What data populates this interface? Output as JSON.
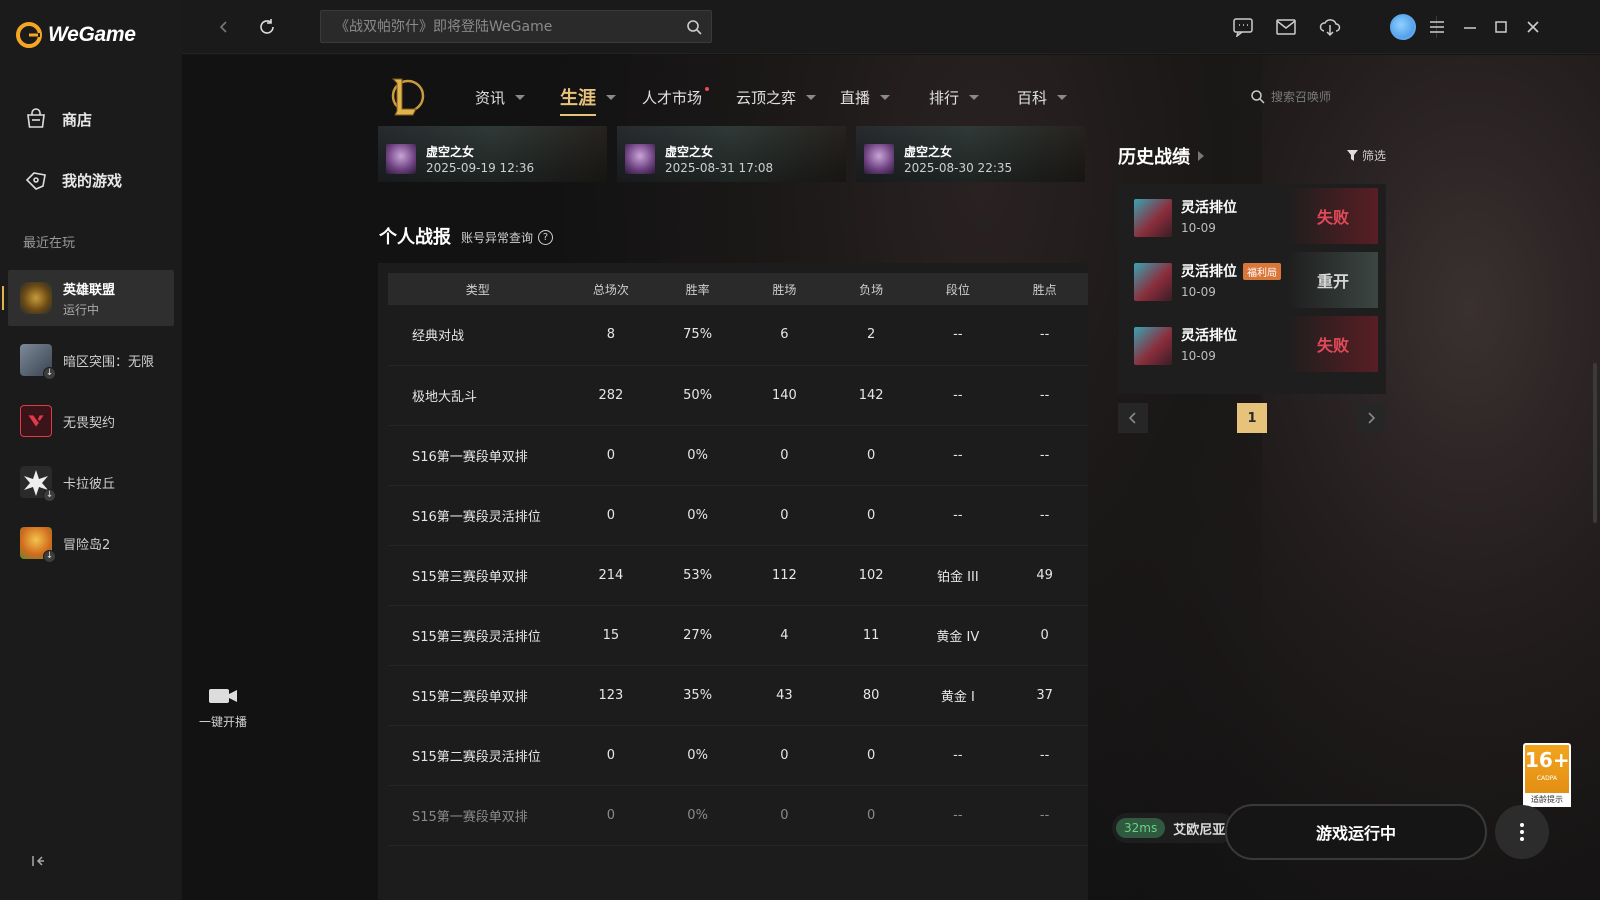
{
  "app": {
    "brand": "WeGame"
  },
  "sidebar": {
    "items": [
      {
        "label": "商店",
        "icon": "store-bag-icon"
      },
      {
        "label": "我的游戏",
        "icon": "gamepad-icon"
      }
    ],
    "recent_label": "最近在玩",
    "games": [
      {
        "name": "英雄联盟",
        "status": "运行中",
        "active": true
      },
      {
        "name": "暗区突围：无限"
      },
      {
        "name": "无畏契约"
      },
      {
        "name": "卡拉彼丘"
      },
      {
        "name": "冒险岛2"
      }
    ]
  },
  "topbar": {
    "search_placeholder": "《战双帕弥什》即将登陆WeGame"
  },
  "lol": {
    "nav": [
      {
        "label": "资讯"
      },
      {
        "label": "生涯",
        "active": true
      },
      {
        "label": "人才市场"
      },
      {
        "label": "云顶之弈"
      },
      {
        "label": "直播"
      },
      {
        "label": "排行"
      },
      {
        "label": "百科"
      }
    ],
    "summoner_search_placeholder": "搜索召唤师",
    "recent_matches": [
      {
        "champion": "虚空之女",
        "time": "2025-09-19 12:36"
      },
      {
        "champion": "虚空之女",
        "time": "2025-08-31 17:08"
      },
      {
        "champion": "虚空之女",
        "time": "2025-08-30 22:35"
      }
    ]
  },
  "stats": {
    "title": "个人战报",
    "link": "账号异常查询",
    "headers": [
      "类型",
      "总场次",
      "胜率",
      "胜场",
      "负场",
      "段位",
      "胜点"
    ],
    "rows": [
      [
        "经典对战",
        "8",
        "75%",
        "6",
        "2",
        "--",
        "--"
      ],
      [
        "极地大乱斗",
        "282",
        "50%",
        "140",
        "142",
        "--",
        "--"
      ],
      [
        "S16第一赛段单双排",
        "0",
        "0%",
        "0",
        "0",
        "--",
        "--"
      ],
      [
        "S16第一赛段灵活排位",
        "0",
        "0%",
        "0",
        "0",
        "--",
        "--"
      ],
      [
        "S15第三赛段单双排",
        "214",
        "53%",
        "112",
        "102",
        "铂金 III",
        "49"
      ],
      [
        "S15第三赛段灵活排位",
        "15",
        "27%",
        "4",
        "11",
        "黄金 IV",
        "0"
      ],
      [
        "S15第二赛段单双排",
        "123",
        "35%",
        "43",
        "80",
        "黄金 I",
        "37"
      ],
      [
        "S15第二赛段灵活排位",
        "0",
        "0%",
        "0",
        "0",
        "--",
        "--"
      ],
      [
        "S15第一赛段单双排",
        "0",
        "0%",
        "0",
        "0",
        "--",
        "--"
      ]
    ]
  },
  "history": {
    "title": "历史战绩",
    "filter": "筛选",
    "matches": [
      {
        "mode": "灵活排位",
        "date": "10-09",
        "result": "失败",
        "kind": "loss"
      },
      {
        "mode": "灵活排位",
        "date": "10-09",
        "result": "重开",
        "kind": "remake",
        "badge": "福利局"
      },
      {
        "mode": "灵活排位",
        "date": "10-09",
        "result": "失败",
        "kind": "loss"
      }
    ],
    "page": "1"
  },
  "stream_label": "一键开播",
  "age_rating": {
    "num": "16+",
    "sub": "CADPA",
    "tip": "适龄提示"
  },
  "footer": {
    "ping": "32ms",
    "server": "艾欧尼亚",
    "run_label": "游戏运行中"
  },
  "colors": {
    "accent": "#e6c27a",
    "loss": "#e24a5a",
    "brand_orange": "#f2a41f"
  }
}
